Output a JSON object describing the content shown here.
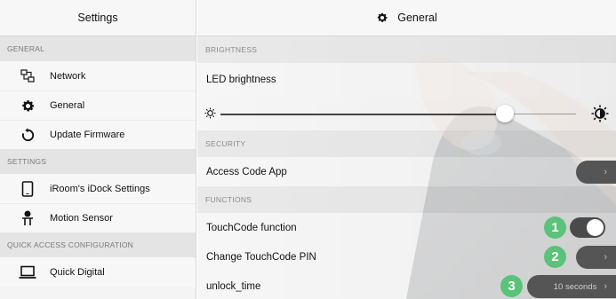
{
  "sidebar": {
    "title": "Settings",
    "sections": [
      {
        "header": "GENERAL",
        "items": [
          {
            "label": "Network",
            "icon": "network-icon"
          },
          {
            "label": "General",
            "icon": "gear-icon"
          },
          {
            "label": "Update Firmware",
            "icon": "refresh-icon"
          }
        ]
      },
      {
        "header": "SETTINGS",
        "items": [
          {
            "label": "iRoom's iDock Settings",
            "icon": "tablet-icon"
          },
          {
            "label": "Motion Sensor",
            "icon": "motion-sensor-icon"
          }
        ]
      },
      {
        "header": "QUICK ACCESS CONFIGURATION",
        "items": [
          {
            "label": "Quick Digital",
            "icon": "laptop-icon"
          }
        ]
      }
    ]
  },
  "main": {
    "title": "General",
    "title_icon": "gear-icon",
    "brightness": {
      "header": "BRIGHTNESS",
      "label": "LED brightness",
      "level": 0.8,
      "min_icon": "sun-small-icon",
      "max_icon": "brightness-contrast-icon"
    },
    "security": {
      "header": "SECURITY",
      "access_code_label": "Access Code App",
      "chevron": "›"
    },
    "functions": {
      "header": "FUNCTIONS",
      "touchcode_label": "TouchCode function",
      "touchcode_on": true,
      "change_pin_label": "Change TouchCode PIN",
      "unlock_label": "unlock_time",
      "unlock_value": "10 seconds",
      "chevron": "›"
    },
    "badges": [
      "1",
      "2",
      "3"
    ]
  },
  "colors": {
    "badge": "#5bc27a",
    "control_dark": "#555555",
    "sidebar_bg": "#f4f4f4"
  }
}
